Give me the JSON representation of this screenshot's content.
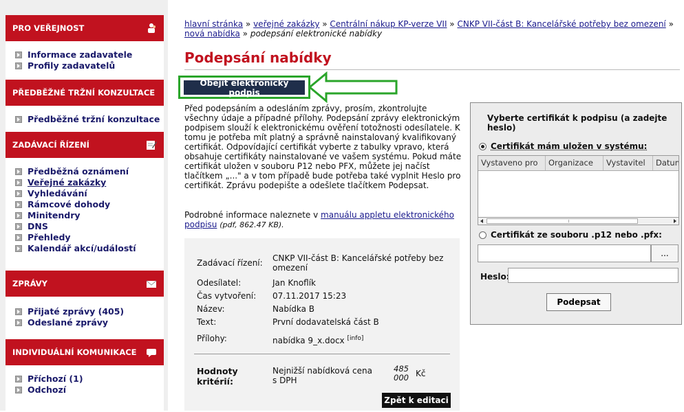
{
  "sidebar": {
    "sections": [
      {
        "title": "PRO VEŘEJNOST",
        "icon": "people-icon",
        "items": [
          {
            "label": "Informace zadavatele"
          },
          {
            "label": "Profily zadavatelů"
          }
        ]
      },
      {
        "title": "PŘEDBĚŽNÉ TRŽNÍ KONZULTACE",
        "items": [
          {
            "label": "Předběžné tržní konzultace"
          }
        ]
      },
      {
        "title": "ZADÁVACÍ ŘÍZENÍ",
        "icon": "edit-icon",
        "items": [
          {
            "label": "Předběžná oznámení"
          },
          {
            "label": "Veřejné zakázky"
          },
          {
            "label": "Vyhledávání"
          },
          {
            "label": "Rámcové dohody"
          },
          {
            "label": "Minitendry"
          },
          {
            "label": "DNS"
          },
          {
            "label": "Přehledy"
          },
          {
            "label": "Kalendář akcí/událostí"
          }
        ]
      },
      {
        "title": "ZPRÁVY",
        "icon": "envelope-icon",
        "items": [
          {
            "label": "Přijaté zprávy (405)"
          },
          {
            "label": "Odeslané zprávy"
          }
        ]
      },
      {
        "title": "INDIVIDUÁLNÍ KOMUNIKACE",
        "icon": "chat-icon",
        "items": [
          {
            "label": "Příchozí (1)"
          },
          {
            "label": "Odchozí"
          }
        ]
      }
    ]
  },
  "breadcrumb": {
    "home": "hlavní stránka",
    "sep": " » ",
    "public": "veřejné zakázky",
    "central": "Centrální nákup KP-verze VII",
    "part": "CNKP VII-část B: Kancelářské potřeby bez omezení",
    "new_offer": "nová nabídka",
    "current": "podepsání elektronické nabídky"
  },
  "page_title": "Podepsání nabídky",
  "bypass_button": "Obejít elektronický podpis",
  "intro": "Před podepsáním a odesláním zprávy, prosím, zkontrolujte všechny údaje a případné přílohy. Podepsání zprávy elektronickým podpisem slouží k elektronickému ověření totožnosti odesílatele. K tomu je potřeba mít platný a správně nainstalovaný kvalifikovaný certifikát. Odpovídající certifikát vyberte z tabulky vpravo, která obsahuje certifikáty nainstalované ve vašem systému. Pokud máte certifikát uložen v souboru P12 nebo PFX, můžete jej načíst tlačítkem „...\" a v tom případě bude potřeba také vyplnit Heslo pro certifikát. Zprávu podepište a odešlete tlačítkem Podepsat.",
  "more_info": {
    "prefix": "Podrobné informace naleznete v ",
    "link": "manuálu appletu elektronického podpisu",
    "meta": "(pdf, 862.47 KB)."
  },
  "summary": {
    "rows": [
      {
        "label": "Zadávací řízení:",
        "value": "CNKP VII-část B: Kancelářské potřeby bez omezení"
      },
      {
        "label": "Odesílatel:",
        "value": "Jan Knoflík"
      },
      {
        "label": "Čas vytvoření:",
        "value": "07.11.2017 15:23"
      },
      {
        "label": "Název:",
        "value": "Nabídka B"
      },
      {
        "label": "Text:",
        "value": "První dodavatelská část B"
      },
      {
        "label": "Přílohy:",
        "value": "nabídka 9_x.docx",
        "sup": "[info]"
      }
    ],
    "criteria_label": "Hodnoty kritérií:",
    "criteria_text": "Nejnižší nabídková cena s DPH",
    "criteria_value": "485 000",
    "criteria_currency": "Kč",
    "back_button": "Zpět k editaci"
  },
  "applet": {
    "title": "Vyberte certifikát k podpisu (a zadejte heslo)",
    "option_system": "Certifikát mám uložen v systému:",
    "columns": [
      "Vystaveno pro",
      "Organizace",
      "Vystavitel",
      "Datum"
    ],
    "option_file": "Certifikát ze souboru .p12 nebo .pfx:",
    "browse": "...",
    "password_label": "Heslo:",
    "sign_button": "Podepsat"
  },
  "colors": {
    "brand_red": "#c1121f",
    "highlight_green": "#2aa52a",
    "nav_blue": "#1a1a8c"
  }
}
